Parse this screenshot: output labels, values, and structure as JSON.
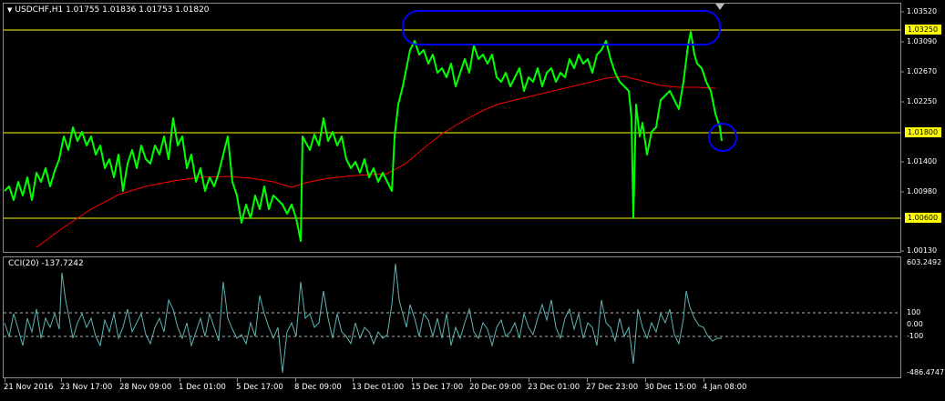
{
  "chart": {
    "title": "USDCHF,H1  1.01755 1.01836 1.01753 1.01820",
    "colors": {
      "background": "#000000",
      "price_line": "#00ff00",
      "ma_line": "#ff0000",
      "level_line": "#ffff00",
      "annotation": "#0000ff",
      "cci_line": "#5fb3b3",
      "grid": "#8a8a8a"
    },
    "price_axis": [
      "1.03520",
      "1.03090",
      "1.02670",
      "1.02250",
      "1.01400",
      "1.00980",
      "1.00130"
    ],
    "level_badges": [
      "1.03250",
      "1.01800",
      "1.00600"
    ]
  },
  "indicator": {
    "title": "CCI(20) -137.7242",
    "axis": [
      "603.2492",
      "100",
      "0.00",
      "-100",
      "-486.4747"
    ]
  },
  "time_axis": [
    "21 Nov 2016",
    "23 Nov 17:00",
    "28 Nov 09:00",
    "1 Dec 01:00",
    "5 Dec 17:00",
    "8 Dec 09:00",
    "13 Dec 01:00",
    "15 Dec 17:00",
    "20 Dec 09:00",
    "23 Dec 01:00",
    "27 Dec 23:00",
    "30 Dec 15:00",
    "4 Jan 08:00"
  ],
  "chart_data": {
    "type": "line",
    "title": "USDCHF,H1",
    "ylim": [
      1.0013,
      1.0352
    ],
    "levels": [
      1.0325,
      1.018,
      1.006
    ],
    "x": [
      "21 Nov 2016",
      "23 Nov 17:00",
      "28 Nov 09:00",
      "1 Dec 01:00",
      "5 Dec 17:00",
      "8 Dec 09:00",
      "13 Dec 01:00",
      "15 Dec 17:00",
      "20 Dec 09:00",
      "23 Dec 01:00",
      "27 Dec 23:00",
      "30 Dec 15:00",
      "4 Jan 08:00"
    ],
    "series": [
      {
        "name": "USDCHF",
        "values": [
          1.0095,
          1.0165,
          1.014,
          1.013,
          1.007,
          1.0175,
          1.0125,
          1.03,
          1.0275,
          1.028,
          1.0215,
          1.0235,
          1.0182
        ]
      },
      {
        "name": "CCI(20)",
        "values": [
          -60,
          150,
          -40,
          60,
          -80,
          40,
          20,
          180,
          -60,
          30,
          -90,
          120,
          -137.7242
        ]
      }
    ]
  }
}
